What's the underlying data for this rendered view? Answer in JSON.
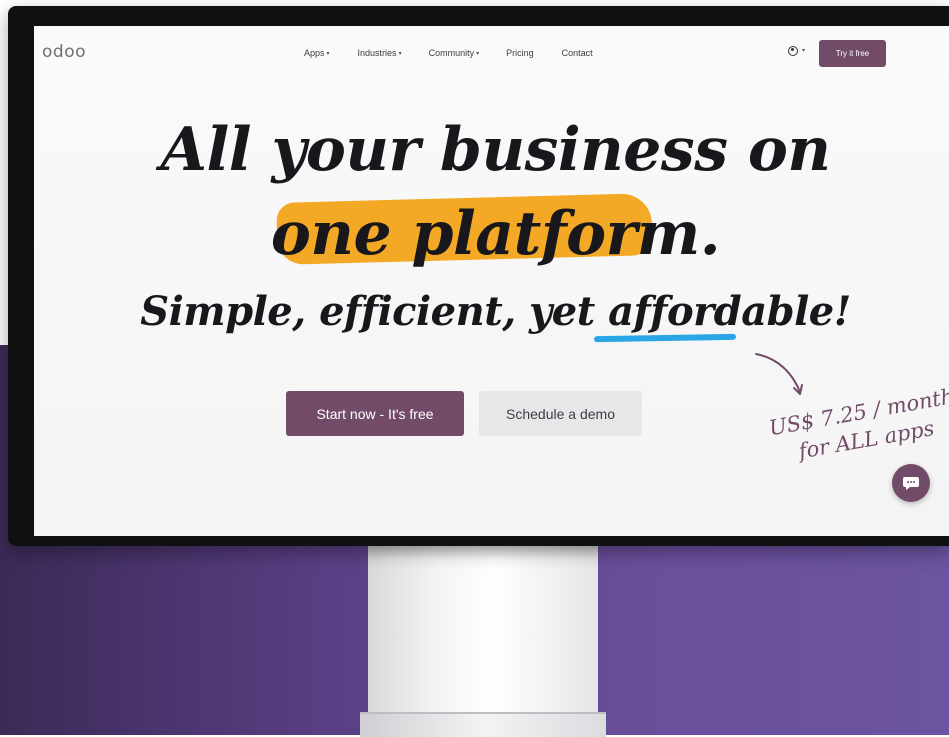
{
  "nav": {
    "logo": "odoo",
    "menu": [
      {
        "label": "Apps",
        "has_caret": true
      },
      {
        "label": "Industries",
        "has_caret": true
      },
      {
        "label": "Community",
        "has_caret": true
      },
      {
        "label": "Pricing",
        "has_caret": false
      },
      {
        "label": "Contact",
        "has_caret": false
      }
    ],
    "try_button": "Try it free",
    "user_icon": "user-circle-icon"
  },
  "hero": {
    "headline_line1": "All your business on",
    "headline_line2": "one platform.",
    "tagline": "Simple, efficient, yet affordable!",
    "primary_button": "Start now - It's free",
    "secondary_button": "Schedule a demo",
    "price_line1": "US$ 7.25 / month",
    "price_line2": "for ALL apps"
  },
  "chat": {
    "icon": "chat-bubble-icon"
  },
  "colors": {
    "brand": "#714b67",
    "highlight": "#f4a926",
    "underline": "#2aa5e6",
    "backdrop": "#5a3f84"
  }
}
